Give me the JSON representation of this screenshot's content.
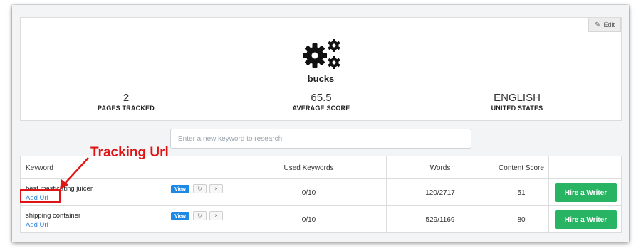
{
  "project": {
    "edit_label": "Edit",
    "edit_icon": "pencil-icon",
    "logo_icon": "gears-icon",
    "name": "bucks",
    "stats": [
      {
        "value": "2",
        "label": "PAGES TRACKED"
      },
      {
        "value": "65.5",
        "label": "AVERAGE SCORE"
      },
      {
        "value": "ENGLISH",
        "label": "UNITED STATES"
      }
    ]
  },
  "search": {
    "placeholder": "Enter a new keyword to research",
    "value": ""
  },
  "table": {
    "headers": [
      "Keyword",
      "Used Keywords",
      "Words",
      "Content Score",
      ""
    ],
    "rows": [
      {
        "keyword": "best masticating juicer",
        "add_url": "Add Url",
        "view": "View",
        "refresh_icon": "refresh-icon",
        "remove_icon": "close-icon",
        "used_keywords": "0/10",
        "words": "120/2717",
        "content_score": "51",
        "hire": "Hire a Writer"
      },
      {
        "keyword": "shipping container",
        "add_url": "Add Url",
        "view": "View",
        "refresh_icon": "refresh-icon",
        "remove_icon": "close-icon",
        "used_keywords": "0/10",
        "words": "529/1169",
        "content_score": "80",
        "hire": "Hire a Writer"
      }
    ]
  },
  "annotation": {
    "label": "Tracking Url",
    "color": "#e01414"
  },
  "colors": {
    "view_button": "#1e88e5",
    "hire_button": "#28b463",
    "link": "#2a7fd4"
  }
}
